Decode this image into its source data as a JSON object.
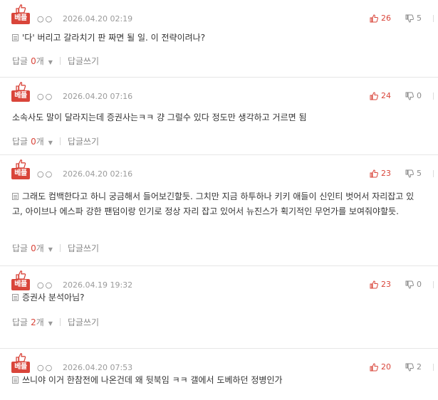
{
  "reply_label": "답글",
  "reply_unit": "개",
  "write_reply_label": "답글쓰기",
  "badge_label": "베플",
  "dots": "○○",
  "colors": {
    "best_red": "#d9453a",
    "muted": "#8a8a8a"
  },
  "comments": [
    {
      "date": "2026.04.20 02:19",
      "up": "26",
      "down": "5",
      "has_doc_icon": true,
      "text": "'다' 버리고 갈라치기 판 짜면 될 일. 이 전략이려나?",
      "reply_count": "0"
    },
    {
      "date": "2026.04.20 07:16",
      "up": "24",
      "down": "0",
      "has_doc_icon": false,
      "text": "소속사도 말이 달라지는데 증권사는ㅋㅋ 걍 그럴수 있다 정도만 생각하고 거르면 됨",
      "reply_count": "0"
    },
    {
      "date": "2026.04.20 02:16",
      "up": "23",
      "down": "5",
      "has_doc_icon": true,
      "text": "그래도 컴백한다고 하니 궁금해서 들어보긴할듯. 그치만 지금 하투하나 키키 애들이 신인티 벗어서 자리잡고 있고, 아이브나 에스파 강한 팬덤이랑 인기로 정상 자리 잡고 있어서 뉴진스가 획기적인 무언가를 보여줘야할듯.",
      "reply_count": "0"
    },
    {
      "date": "2026.04.19 19:32",
      "up": "23",
      "down": "0",
      "has_doc_icon": true,
      "text": "증권사 분석아님?",
      "reply_count": "2"
    },
    {
      "date": "2026.04.20 07:53",
      "up": "20",
      "down": "2",
      "has_doc_icon": true,
      "text": "쓰니야 이거 한참전에 나온건데 왜 뒷북임 ㅋㅋ 갤에서 도베하던 정병인가",
      "reply_count": ""
    }
  ]
}
